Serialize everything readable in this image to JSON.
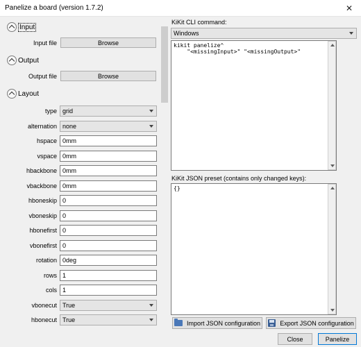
{
  "window": {
    "title": "Panelize a board  (version 1.7.2)",
    "close_glyph": "✕"
  },
  "sections": {
    "input": {
      "label": "Input",
      "file_label": "Input file",
      "browse": "Browse"
    },
    "output": {
      "label": "Output",
      "file_label": "Output file",
      "browse": "Browse"
    },
    "layout": {
      "label": "Layout"
    }
  },
  "layout_fields": [
    {
      "label": "type",
      "value": "grid",
      "kind": "combo"
    },
    {
      "label": "alternation",
      "value": "none",
      "kind": "combo"
    },
    {
      "label": "hspace",
      "value": "0mm",
      "kind": "text"
    },
    {
      "label": "vspace",
      "value": "0mm",
      "kind": "text"
    },
    {
      "label": "hbackbone",
      "value": "0mm",
      "kind": "text"
    },
    {
      "label": "vbackbone",
      "value": "0mm",
      "kind": "text"
    },
    {
      "label": "hboneskip",
      "value": "0",
      "kind": "text"
    },
    {
      "label": "vboneskip",
      "value": "0",
      "kind": "text"
    },
    {
      "label": "hbonefirst",
      "value": "0",
      "kind": "text"
    },
    {
      "label": "vbonefirst",
      "value": "0",
      "kind": "text"
    },
    {
      "label": "rotation",
      "value": "0deg",
      "kind": "text"
    },
    {
      "label": "rows",
      "value": "1",
      "kind": "text"
    },
    {
      "label": "cols",
      "value": "1",
      "kind": "text"
    },
    {
      "label": "vbonecut",
      "value": "True",
      "kind": "combo"
    },
    {
      "label": "hbonecut",
      "value": "True",
      "kind": "combo"
    }
  ],
  "cli": {
    "label": "KiKit CLI command:",
    "platform": "Windows",
    "command": "kikit panelize^\n    \"<missingInput>\" \"<missingOutput>\""
  },
  "preset": {
    "label": "KiKit JSON preset (contains only changed keys):",
    "content": "{}"
  },
  "buttons": {
    "import": "Import JSON configuration",
    "export": "Export JSON configuration",
    "close": "Close",
    "panelize": "Panelize"
  }
}
